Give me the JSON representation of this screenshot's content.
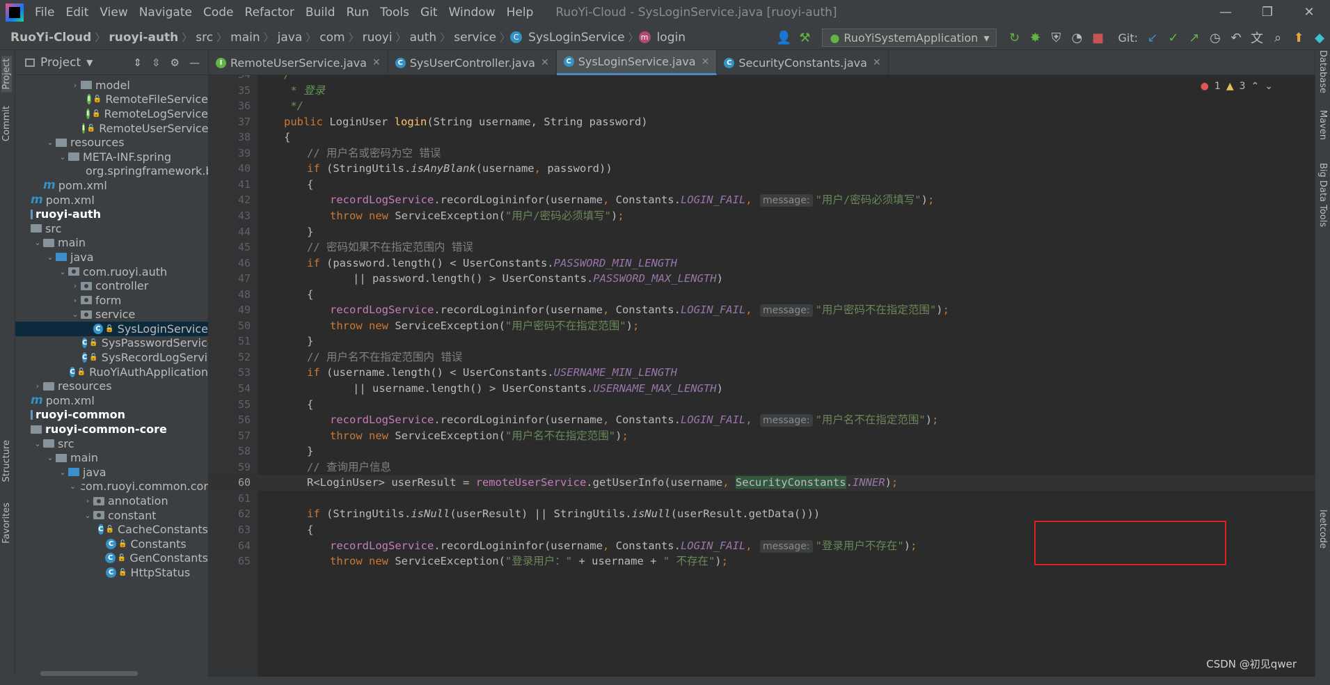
{
  "window": {
    "title": "RuoYi-Cloud - SysLoginService.java [ruoyi-auth]",
    "menu": [
      "File",
      "Edit",
      "View",
      "Navigate",
      "Code",
      "Refactor",
      "Build",
      "Run",
      "Tools",
      "Git",
      "Window",
      "Help"
    ]
  },
  "breadcrumb": [
    "RuoYi-Cloud",
    "ruoyi-auth",
    "src",
    "main",
    "java",
    "com",
    "ruoyi",
    "auth",
    "service",
    "SysLoginService",
    "login"
  ],
  "toolbar": {
    "run_config": "RuoYiSystemApplication",
    "git_label": "Git:"
  },
  "left_strip": {
    "project": "Project",
    "commit": "Commit",
    "structure": "Structure",
    "favorites": "Favorites"
  },
  "right_strip": {
    "database": "Database",
    "maven": "Maven",
    "bigdata": "Big Data Tools",
    "leetcode": "leetcode"
  },
  "project_panel": {
    "title": "Project",
    "tree": [
      {
        "label": "model",
        "indent": 4,
        "kind": "folder",
        "arrow": "›"
      },
      {
        "label": "RemoteFileService",
        "indent": 5,
        "kind": "interface"
      },
      {
        "label": "RemoteLogService",
        "indent": 5,
        "kind": "interface"
      },
      {
        "label": "RemoteUserService",
        "indent": 5,
        "kind": "interface"
      },
      {
        "label": "resources",
        "indent": 2,
        "kind": "folder",
        "arrow": "⌄"
      },
      {
        "label": "META-INF.spring",
        "indent": 3,
        "kind": "folder",
        "arrow": "⌄"
      },
      {
        "label": "org.springframework.boot",
        "indent": 5,
        "kind": "file"
      },
      {
        "label": "pom.xml",
        "indent": 1,
        "kind": "maven"
      },
      {
        "label": "pom.xml",
        "indent": 0,
        "kind": "maven"
      },
      {
        "label": "ruoyi-auth",
        "indent": 0,
        "kind": "module"
      },
      {
        "label": "src",
        "indent": 0,
        "kind": "folder"
      },
      {
        "label": "main",
        "indent": 1,
        "kind": "folder",
        "arrow": "⌄"
      },
      {
        "label": "java",
        "indent": 2,
        "kind": "bluefolder",
        "arrow": "⌄"
      },
      {
        "label": "com.ruoyi.auth",
        "indent": 3,
        "kind": "package",
        "arrow": "⌄"
      },
      {
        "label": "controller",
        "indent": 4,
        "kind": "package",
        "arrow": "›"
      },
      {
        "label": "form",
        "indent": 4,
        "kind": "package",
        "arrow": "›"
      },
      {
        "label": "service",
        "indent": 4,
        "kind": "package",
        "arrow": "⌄"
      },
      {
        "label": "SysLoginService",
        "indent": 5,
        "kind": "class",
        "selected": true
      },
      {
        "label": "SysPasswordService",
        "indent": 5,
        "kind": "class"
      },
      {
        "label": "SysRecordLogService",
        "indent": 5,
        "kind": "class"
      },
      {
        "label": "RuoYiAuthApplication",
        "indent": 4,
        "kind": "class"
      },
      {
        "label": "resources",
        "indent": 1,
        "kind": "folder",
        "arrow": "›"
      },
      {
        "label": "pom.xml",
        "indent": 0,
        "kind": "maven"
      },
      {
        "label": "ruoyi-common",
        "indent": 0,
        "kind": "module"
      },
      {
        "label": "ruoyi-common-core",
        "indent": 0,
        "kind": "modulefolder"
      },
      {
        "label": "src",
        "indent": 1,
        "kind": "folder",
        "arrow": "⌄"
      },
      {
        "label": "main",
        "indent": 2,
        "kind": "folder",
        "arrow": "⌄"
      },
      {
        "label": "java",
        "indent": 3,
        "kind": "bluefolder",
        "arrow": "⌄"
      },
      {
        "label": "com.ruoyi.common.core",
        "indent": 4,
        "kind": "package",
        "arrow": "⌄"
      },
      {
        "label": "annotation",
        "indent": 5,
        "kind": "package",
        "arrow": "›"
      },
      {
        "label": "constant",
        "indent": 5,
        "kind": "package",
        "arrow": "⌄"
      },
      {
        "label": "CacheConstants",
        "indent": 6,
        "kind": "class"
      },
      {
        "label": "Constants",
        "indent": 6,
        "kind": "class"
      },
      {
        "label": "GenConstants",
        "indent": 6,
        "kind": "class"
      },
      {
        "label": "HttpStatus",
        "indent": 6,
        "kind": "class"
      }
    ]
  },
  "tabs": [
    {
      "label": "RemoteUserService.java",
      "icon": "I"
    },
    {
      "label": "SysUserController.java",
      "icon": "C"
    },
    {
      "label": "SysLoginService.java",
      "icon": "C",
      "active": true
    },
    {
      "label": "SecurityConstants.java",
      "icon": "C"
    }
  ],
  "inspections": {
    "errors": "1",
    "warnings": "3"
  },
  "code_lines": [
    {
      "n": "34",
      "indent": 1,
      "segs": [
        [
          "doc",
          "/**"
        ]
      ]
    },
    {
      "n": "35",
      "indent": 1,
      "segs": [
        [
          "doc",
          " * 登录"
        ]
      ]
    },
    {
      "n": "36",
      "indent": 1,
      "segs": [
        [
          "doc",
          " */"
        ]
      ]
    },
    {
      "n": "37",
      "indent": 1,
      "segs": [
        [
          "kw",
          "public "
        ],
        [
          "",
          "LoginUser "
        ],
        [
          "mth",
          "login"
        ],
        [
          "",
          "(String username, String password)"
        ]
      ]
    },
    {
      "n": "38",
      "indent": 1,
      "segs": [
        [
          "",
          "{"
        ]
      ]
    },
    {
      "n": "39",
      "indent": 2,
      "segs": [
        [
          "cm",
          "// 用户名或密码为空 错误"
        ]
      ]
    },
    {
      "n": "40",
      "indent": 2,
      "segs": [
        [
          "kw",
          "if "
        ],
        [
          "",
          "(StringUtils."
        ],
        [
          "st",
          "isAnyBlank"
        ],
        [
          "",
          "(username"
        ],
        [
          "kw",
          ", "
        ],
        [
          "",
          "password))"
        ]
      ]
    },
    {
      "n": "41",
      "indent": 2,
      "segs": [
        [
          "",
          "{"
        ]
      ]
    },
    {
      "n": "42",
      "indent": 3,
      "segs": [
        [
          "var",
          "recordLogService"
        ],
        [
          "",
          ".recordLogininfor(username"
        ],
        [
          "kw",
          ", "
        ],
        [
          "",
          "Constants."
        ],
        [
          "fld",
          "LOGIN_FAIL"
        ],
        [
          "kw",
          ", "
        ],
        [
          "hint",
          "message:"
        ],
        [
          "str",
          "\"用户/密码必须填写\""
        ],
        [
          "",
          ")"
        ],
        [
          "kw",
          ";"
        ]
      ]
    },
    {
      "n": "43",
      "indent": 3,
      "segs": [
        [
          "kw",
          "throw new "
        ],
        [
          "",
          "ServiceException("
        ],
        [
          "str",
          "\"用户/密码必须填写\""
        ],
        [
          "",
          ")"
        ],
        [
          "kw",
          ";"
        ]
      ]
    },
    {
      "n": "44",
      "indent": 2,
      "segs": [
        [
          "",
          "}"
        ]
      ]
    },
    {
      "n": "45",
      "indent": 2,
      "segs": [
        [
          "cm",
          "// 密码如果不在指定范围内 错误"
        ]
      ]
    },
    {
      "n": "46",
      "indent": 2,
      "segs": [
        [
          "kw",
          "if "
        ],
        [
          "",
          "(password.length() < UserConstants."
        ],
        [
          "fld",
          "PASSWORD_MIN_LENGTH"
        ]
      ]
    },
    {
      "n": "47",
      "indent": 4,
      "segs": [
        [
          "",
          "|| password.length() > UserConstants."
        ],
        [
          "fld",
          "PASSWORD_MAX_LENGTH"
        ],
        [
          "",
          ")"
        ]
      ]
    },
    {
      "n": "48",
      "indent": 2,
      "segs": [
        [
          "",
          "{"
        ]
      ]
    },
    {
      "n": "49",
      "indent": 3,
      "segs": [
        [
          "var",
          "recordLogService"
        ],
        [
          "",
          ".recordLogininfor(username"
        ],
        [
          "kw",
          ", "
        ],
        [
          "",
          "Constants."
        ],
        [
          "fld",
          "LOGIN_FAIL"
        ],
        [
          "kw",
          ", "
        ],
        [
          "hint",
          "message:"
        ],
        [
          "str",
          "\"用户密码不在指定范围\""
        ],
        [
          "",
          ")"
        ],
        [
          "kw",
          ";"
        ]
      ]
    },
    {
      "n": "50",
      "indent": 3,
      "segs": [
        [
          "kw",
          "throw new "
        ],
        [
          "",
          "ServiceException("
        ],
        [
          "str",
          "\"用户密码不在指定范围\""
        ],
        [
          "",
          ")"
        ],
        [
          "kw",
          ";"
        ]
      ]
    },
    {
      "n": "51",
      "indent": 2,
      "segs": [
        [
          "",
          "}"
        ]
      ]
    },
    {
      "n": "52",
      "indent": 2,
      "segs": [
        [
          "cm",
          "// 用户名不在指定范围内 错误"
        ]
      ]
    },
    {
      "n": "53",
      "indent": 2,
      "segs": [
        [
          "kw",
          "if "
        ],
        [
          "",
          "(username.length() < UserConstants."
        ],
        [
          "fld",
          "USERNAME_MIN_LENGTH"
        ]
      ]
    },
    {
      "n": "54",
      "indent": 4,
      "segs": [
        [
          "",
          "|| username.length() > UserConstants."
        ],
        [
          "fld",
          "USERNAME_MAX_LENGTH"
        ],
        [
          "",
          ")"
        ]
      ]
    },
    {
      "n": "55",
      "indent": 2,
      "segs": [
        [
          "",
          "{"
        ]
      ]
    },
    {
      "n": "56",
      "indent": 3,
      "segs": [
        [
          "var",
          "recordLogService"
        ],
        [
          "",
          ".recordLogininfor(username"
        ],
        [
          "kw",
          ", "
        ],
        [
          "",
          "Constants."
        ],
        [
          "fld",
          "LOGIN_FAIL"
        ],
        [
          "kw",
          ", "
        ],
        [
          "hint",
          "message:"
        ],
        [
          "str",
          "\"用户名不在指定范围\""
        ],
        [
          "",
          ")"
        ],
        [
          "kw",
          ";"
        ]
      ]
    },
    {
      "n": "57",
      "indent": 3,
      "segs": [
        [
          "kw",
          "throw new "
        ],
        [
          "",
          "ServiceException("
        ],
        [
          "str",
          "\"用户名不在指定范围\""
        ],
        [
          "",
          ")"
        ],
        [
          "kw",
          ";"
        ]
      ]
    },
    {
      "n": "58",
      "indent": 2,
      "segs": [
        [
          "",
          "}"
        ]
      ]
    },
    {
      "n": "59",
      "indent": 2,
      "segs": [
        [
          "cm",
          "// 查询用户信息"
        ]
      ]
    },
    {
      "n": "60",
      "indent": 2,
      "current": true,
      "segs": [
        [
          "",
          "R<LoginUser> userResult = "
        ],
        [
          "var",
          "remoteUserService"
        ],
        [
          "",
          ".getUserInfo(username"
        ],
        [
          "kw",
          ", "
        ],
        [
          "hl",
          "SecurityConstants"
        ],
        [
          "",
          "."
        ],
        [
          "fld",
          "INNER"
        ],
        [
          "",
          ")"
        ],
        [
          "kw",
          ";"
        ]
      ]
    },
    {
      "n": "61",
      "indent": 0,
      "segs": []
    },
    {
      "n": "62",
      "indent": 2,
      "segs": [
        [
          "kw",
          "if "
        ],
        [
          "",
          "(StringUtils."
        ],
        [
          "st",
          "isNull"
        ],
        [
          "",
          "(userResult) || StringUtils."
        ],
        [
          "st",
          "isNull"
        ],
        [
          "",
          "(userResult.getData()))"
        ]
      ]
    },
    {
      "n": "63",
      "indent": 2,
      "segs": [
        [
          "",
          "{"
        ]
      ]
    },
    {
      "n": "64",
      "indent": 3,
      "segs": [
        [
          "var",
          "recordLogService"
        ],
        [
          "",
          ".recordLogininfor(username"
        ],
        [
          "kw",
          ", "
        ],
        [
          "",
          "Constants."
        ],
        [
          "fld",
          "LOGIN_FAIL"
        ],
        [
          "kw",
          ", "
        ],
        [
          "hint",
          "message:"
        ],
        [
          "str",
          "\"登录用户不存在\""
        ],
        [
          "",
          ")"
        ],
        [
          "kw",
          ";"
        ]
      ]
    },
    {
      "n": "65",
      "indent": 3,
      "segs": [
        [
          "kw",
          "throw new "
        ],
        [
          "",
          "ServiceException("
        ],
        [
          "str",
          "\"登录用户：\""
        ],
        [
          "",
          " + username + "
        ],
        [
          "str",
          "\" 不存在\""
        ],
        [
          "",
          ")"
        ],
        [
          "kw",
          ";"
        ]
      ]
    }
  ],
  "watermark": "CSDN @初见qwer"
}
